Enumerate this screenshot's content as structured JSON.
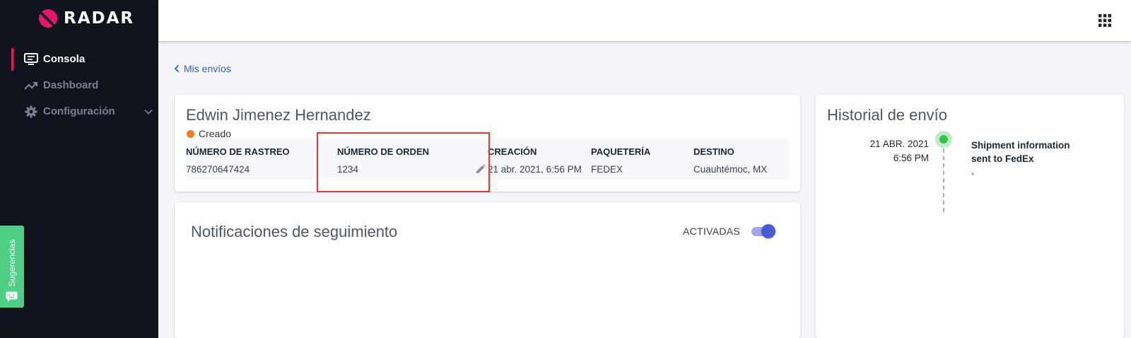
{
  "brand": {
    "name": "RADAR",
    "accent_color": "#e6166f"
  },
  "sidebar": {
    "items": [
      {
        "label": "Consola",
        "icon": "monitor-icon",
        "active": true
      },
      {
        "label": "Dashboard",
        "icon": "trending-up-icon",
        "active": false
      },
      {
        "label": "Configuración",
        "icon": "gear-icon",
        "active": false,
        "expandable": true
      }
    ],
    "feedback_label": "Sugerencias"
  },
  "topbar": {
    "apps_icon": "apps-grid-icon"
  },
  "back_link": {
    "label": "Mis envíos"
  },
  "shipment": {
    "customer_name": "Edwin Jimenez Hernandez",
    "status": {
      "label": "Creado",
      "color": "#f47b20"
    },
    "columns": [
      {
        "header": "NÚMERO DE RASTREO",
        "value": "786270647424"
      },
      {
        "header": "NÚMERO DE ORDEN",
        "value": "1234",
        "editable": true
      },
      {
        "header": "CREACIÓN",
        "value": "21 abr. 2021, 6:56 PM"
      },
      {
        "header": "PAQUETERÍA",
        "value": "FEDEX"
      },
      {
        "header": "DESTINO",
        "value": "Cuauhtémoc, MX"
      }
    ]
  },
  "notifications": {
    "title": "Notificaciones de seguimiento",
    "toggle_label": "ACTIVADAS",
    "enabled": true
  },
  "history": {
    "title": "Historial de envío",
    "events": [
      {
        "date": "21 ABR. 2021",
        "time": "6:56 PM",
        "description": "Shipment information sent to FedEx",
        "location": ","
      }
    ]
  }
}
